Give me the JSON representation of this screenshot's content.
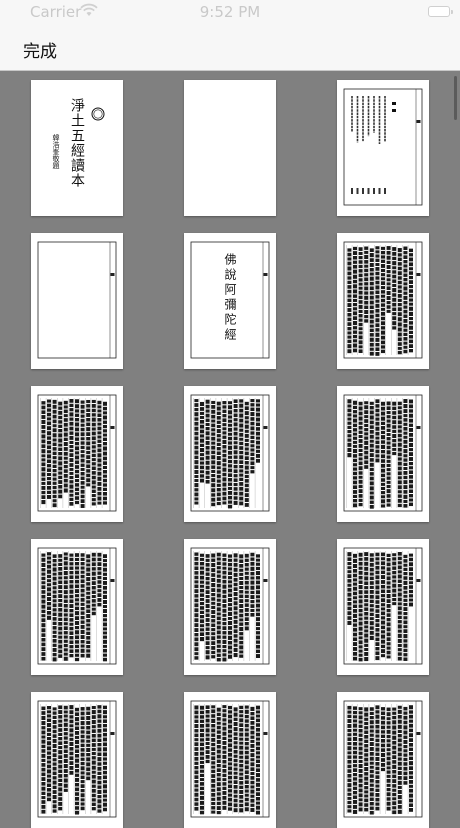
{
  "status_bar": {
    "carrier": "Carrier",
    "time": "9:52 PM"
  },
  "nav": {
    "done_label": "完成"
  },
  "pages": [
    {
      "kind": "cover",
      "title": "淨土五經讀本",
      "signature": "韓浩峯敬題"
    },
    {
      "kind": "blank"
    },
    {
      "kind": "contents"
    },
    {
      "kind": "blank-frame"
    },
    {
      "kind": "sutra-title",
      "title": "佛說阿彌陀經"
    },
    {
      "kind": "text"
    },
    {
      "kind": "text"
    },
    {
      "kind": "text"
    },
    {
      "kind": "text"
    },
    {
      "kind": "text"
    },
    {
      "kind": "text"
    },
    {
      "kind": "text"
    },
    {
      "kind": "text"
    },
    {
      "kind": "text"
    },
    {
      "kind": "text"
    }
  ]
}
